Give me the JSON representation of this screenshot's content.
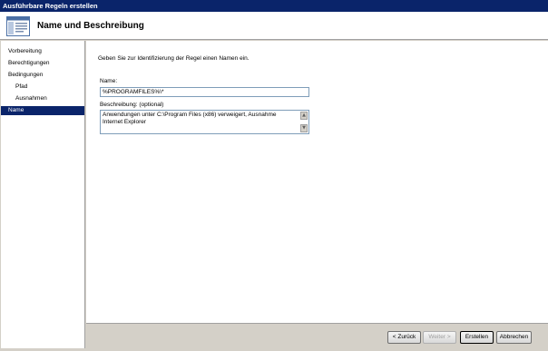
{
  "window": {
    "title": "Ausführbare Regeln erstellen"
  },
  "header": {
    "title": "Name und Beschreibung",
    "icon": "wizard-page-icon"
  },
  "sidebar": {
    "items": [
      {
        "label": "Vorbereitung",
        "active": false,
        "sub": false
      },
      {
        "label": "Berechtigungen",
        "active": false,
        "sub": false
      },
      {
        "label": "Bedingungen",
        "active": false,
        "sub": false
      },
      {
        "label": "Pfad",
        "active": false,
        "sub": true
      },
      {
        "label": "Ausnahmen",
        "active": false,
        "sub": true
      },
      {
        "label": "Name",
        "active": true,
        "sub": false
      }
    ]
  },
  "main": {
    "instruction": "Geben Sie zur Identifizierung der Regel einen Namen ein.",
    "name_label": "Name:",
    "name_value": "%PROGRAMFILES%\\*",
    "description_label": "Beschreibung: (optional)",
    "description_value": "Anwendungen unter C:\\Program Files (x86) verweigert, Ausnahme Internet Explorer"
  },
  "footer": {
    "back_label": "< Zurück",
    "next_label": "Weiter >",
    "create_label": "Erstellen",
    "cancel_label": "Abbrechen"
  },
  "colors": {
    "titlebar": "#0a246a",
    "selection": "#0a246a",
    "dialog_bg": "#d4d0c8"
  }
}
